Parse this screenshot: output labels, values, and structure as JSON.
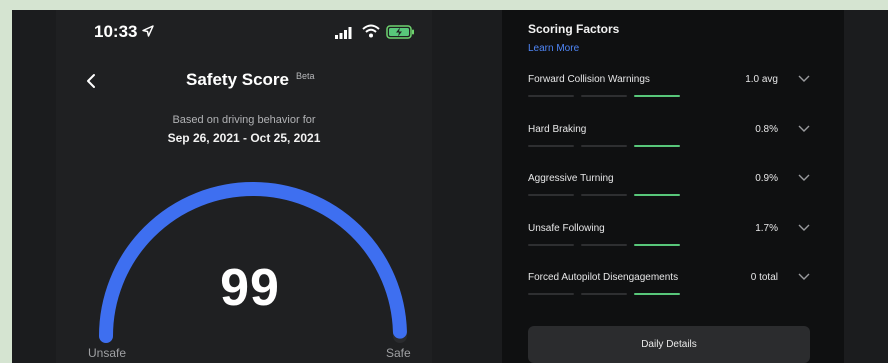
{
  "status_bar": {
    "time": "10:33"
  },
  "header": {
    "title": "Safety Score",
    "beta": "Beta"
  },
  "summary": {
    "subtitle": "Based on driving behavior for",
    "date_range": "Sep 26, 2021 - Oct 25, 2021",
    "score": "99",
    "score_value": 99,
    "gauge_min_label": "Unsafe",
    "gauge_max_label": "Safe"
  },
  "scoring_factors": {
    "title": "Scoring Factors",
    "learn_more": "Learn More",
    "items": [
      {
        "name": "Forward Collision Warnings",
        "value": "1.0 avg",
        "level": 3
      },
      {
        "name": "Hard Braking",
        "value": "0.8%",
        "level": 3
      },
      {
        "name": "Aggressive Turning",
        "value": "0.9%",
        "level": 3
      },
      {
        "name": "Unsafe Following",
        "value": "1.7%",
        "level": 3
      },
      {
        "name": "Forced Autopilot Disengagements",
        "value": "0 total",
        "level": 3
      }
    ],
    "daily_details": "Daily Details"
  },
  "colors": {
    "accent_blue": "#3e6ff0",
    "good_green": "#58c77a",
    "inactive_segment": "#2e2f31",
    "link_blue": "#4f86f7"
  }
}
